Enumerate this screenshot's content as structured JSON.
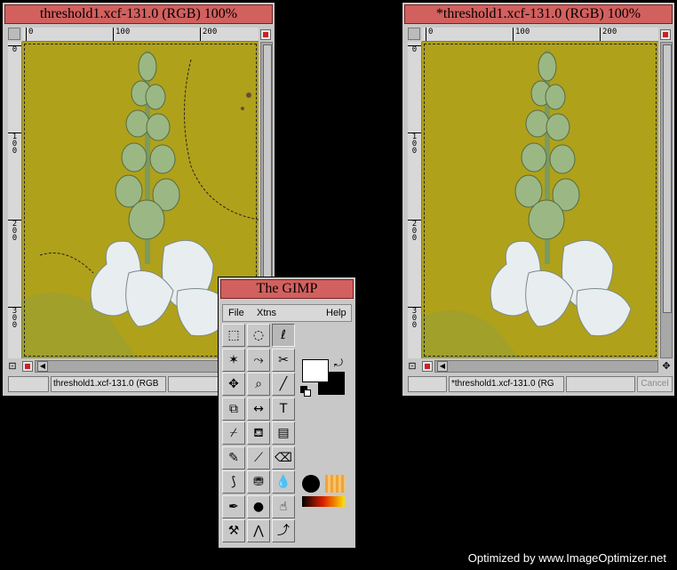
{
  "left_window": {
    "title": "threshold1.xcf-131.0 (RGB) 100%",
    "status": "threshold1.xcf-131.0 (RGB"
  },
  "right_window": {
    "title": "*threshold1.xcf-131.0 (RGB) 100%",
    "status": "*threshold1.xcf-131.0 (RG",
    "cancel_label": "Cancel"
  },
  "ruler": {
    "h_labels": [
      "0",
      "100",
      "200"
    ],
    "v_labels": [
      [
        "0"
      ],
      [
        "1",
        "0",
        "0"
      ],
      [
        "2",
        "0",
        "0"
      ],
      [
        "3",
        "0",
        "0"
      ]
    ]
  },
  "toolbox": {
    "title": "The GIMP",
    "menu": {
      "file": "File",
      "xtns": "Xtns",
      "help": "Help"
    },
    "tools": [
      {
        "name": "rect-select-icon",
        "glyph": "⬚"
      },
      {
        "name": "ellipse-select-icon",
        "glyph": "◌"
      },
      {
        "name": "free-select-icon",
        "glyph": "ℓ"
      },
      {
        "name": "fuzzy-select-icon",
        "glyph": "✶"
      },
      {
        "name": "bezier-select-icon",
        "glyph": "⤳"
      },
      {
        "name": "scissors-icon",
        "glyph": "✂"
      },
      {
        "name": "move-icon",
        "glyph": "✥"
      },
      {
        "name": "magnify-icon",
        "glyph": "⌕"
      },
      {
        "name": "crop-icon",
        "glyph": "╱"
      },
      {
        "name": "transform-icon",
        "glyph": "⧉"
      },
      {
        "name": "flip-icon",
        "glyph": "↔"
      },
      {
        "name": "text-icon",
        "glyph": "T"
      },
      {
        "name": "color-picker-icon",
        "glyph": "⌿"
      },
      {
        "name": "bucket-fill-icon",
        "glyph": "⛾"
      },
      {
        "name": "blend-icon",
        "glyph": "▤"
      },
      {
        "name": "pencil-icon",
        "glyph": "✎"
      },
      {
        "name": "paintbrush-icon",
        "glyph": "⟋"
      },
      {
        "name": "eraser-icon",
        "glyph": "⌫"
      },
      {
        "name": "airbrush-icon",
        "glyph": "⟆"
      },
      {
        "name": "clone-icon",
        "glyph": "⛃"
      },
      {
        "name": "convolve-icon",
        "glyph": "💧"
      },
      {
        "name": "ink-icon",
        "glyph": "✒"
      },
      {
        "name": "dodge-burn-icon",
        "glyph": "●"
      },
      {
        "name": "smudge-icon",
        "glyph": "☝"
      },
      {
        "name": "measure-icon",
        "glyph": "⚒"
      },
      {
        "name": "measure-compass-icon",
        "glyph": "⋀"
      },
      {
        "name": "path-icon",
        "glyph": "⤴"
      }
    ],
    "colors": {
      "fg": "#ffffff",
      "bg": "#000000",
      "swap_glyph": "⤾"
    }
  },
  "watermark": "Optimized by www.ImageOptimizer.net"
}
